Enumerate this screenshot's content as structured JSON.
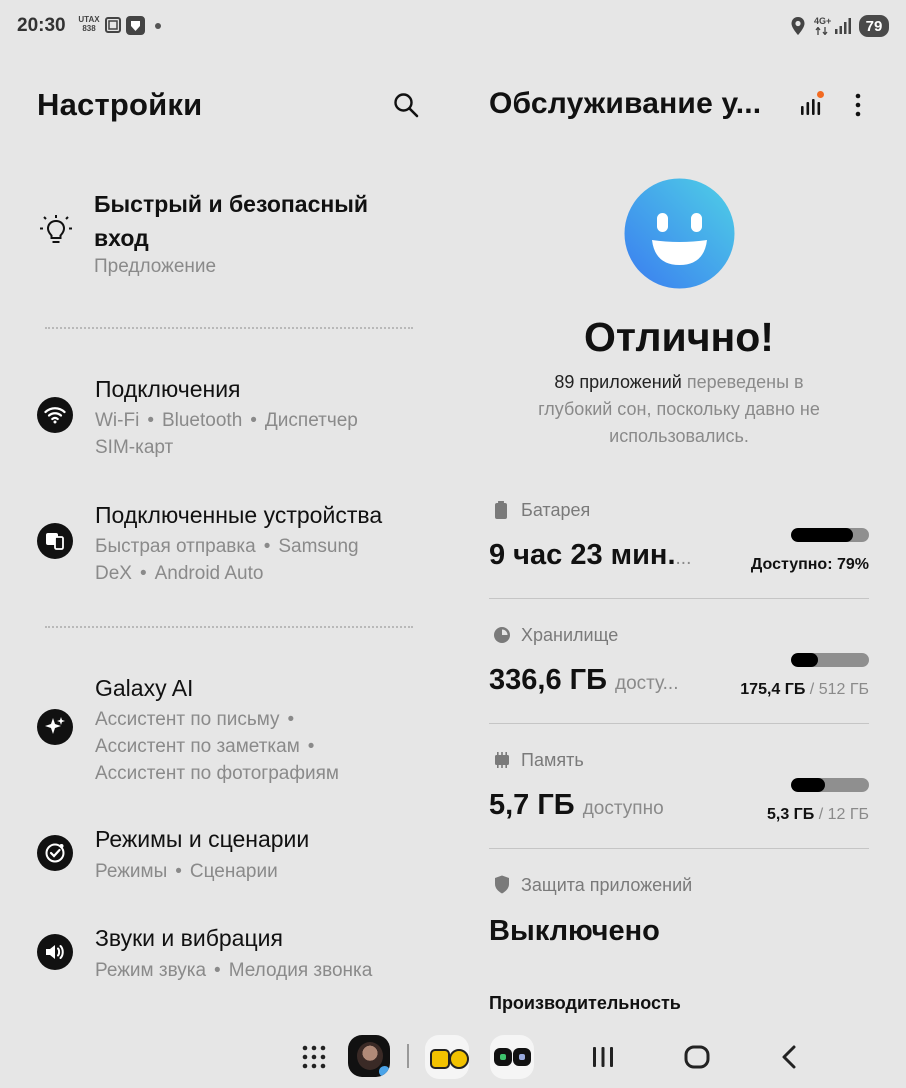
{
  "status": {
    "time": "20:30",
    "notif_text_1": "UTAX",
    "notif_text_2": "838",
    "network": "4G+",
    "battery": "79"
  },
  "left": {
    "title": "Настройки",
    "suggestion": {
      "title_line1": "Быстрый и безопасный",
      "title_line2": "вход",
      "subtitle": "Предложение"
    },
    "connections": {
      "title": "Подключения",
      "sub1": "Wi-Fi",
      "sub2": "Bluetooth",
      "sub3": "Диспетчер",
      "sub4": "SIM-карт"
    },
    "devices": {
      "title": "Подключенные устройства",
      "sub1": "Быстрая отправка",
      "sub2": "Samsung",
      "sub3": "DeX",
      "sub4": "Android Auto"
    },
    "galaxy_ai": {
      "title": "Galaxy AI",
      "sub1": "Ассистент по письму",
      "sub2": "Ассистент по заметкам",
      "sub3": "Ассистент по фотографиям"
    },
    "modes": {
      "title": "Режимы и сценарии",
      "sub1": "Режимы",
      "sub2": "Сценарии"
    },
    "sounds": {
      "title": "Звуки и вибрация",
      "sub1": "Режим звука",
      "sub2": "Мелодия звонка"
    }
  },
  "right": {
    "title": "Обслуживание у...",
    "status_title": "Отлично!",
    "desc_count": "89 приложений",
    "desc_rest_1": "переведены в",
    "desc_line2": "глубокий сон, поскольку давно не",
    "desc_line3": "использовались.",
    "battery": {
      "label": "Батарея",
      "value": "9 час 23 мин.",
      "ellipsis": "...",
      "available": "Доступно: 79%",
      "fill": 0.79
    },
    "storage": {
      "label": "Хранилище",
      "value": "336,6 ГБ",
      "unit": "досту...",
      "used": "175,4 ГБ",
      "total": "/ 512 ГБ",
      "fill": 0.34
    },
    "memory": {
      "label": "Память",
      "value": "5,7 ГБ",
      "unit": "доступно",
      "used": "5,3 ГБ",
      "total": "/ 12 ГБ",
      "fill": 0.44
    },
    "protection": {
      "label": "Защита приложений",
      "value": "Выключено"
    },
    "performance": "Производительность"
  },
  "colors": {
    "background": "#e6e6e6",
    "accent_dot": "#f26a21",
    "face_top": "#4fd0e6",
    "face_bottom": "#3a7cf0"
  }
}
